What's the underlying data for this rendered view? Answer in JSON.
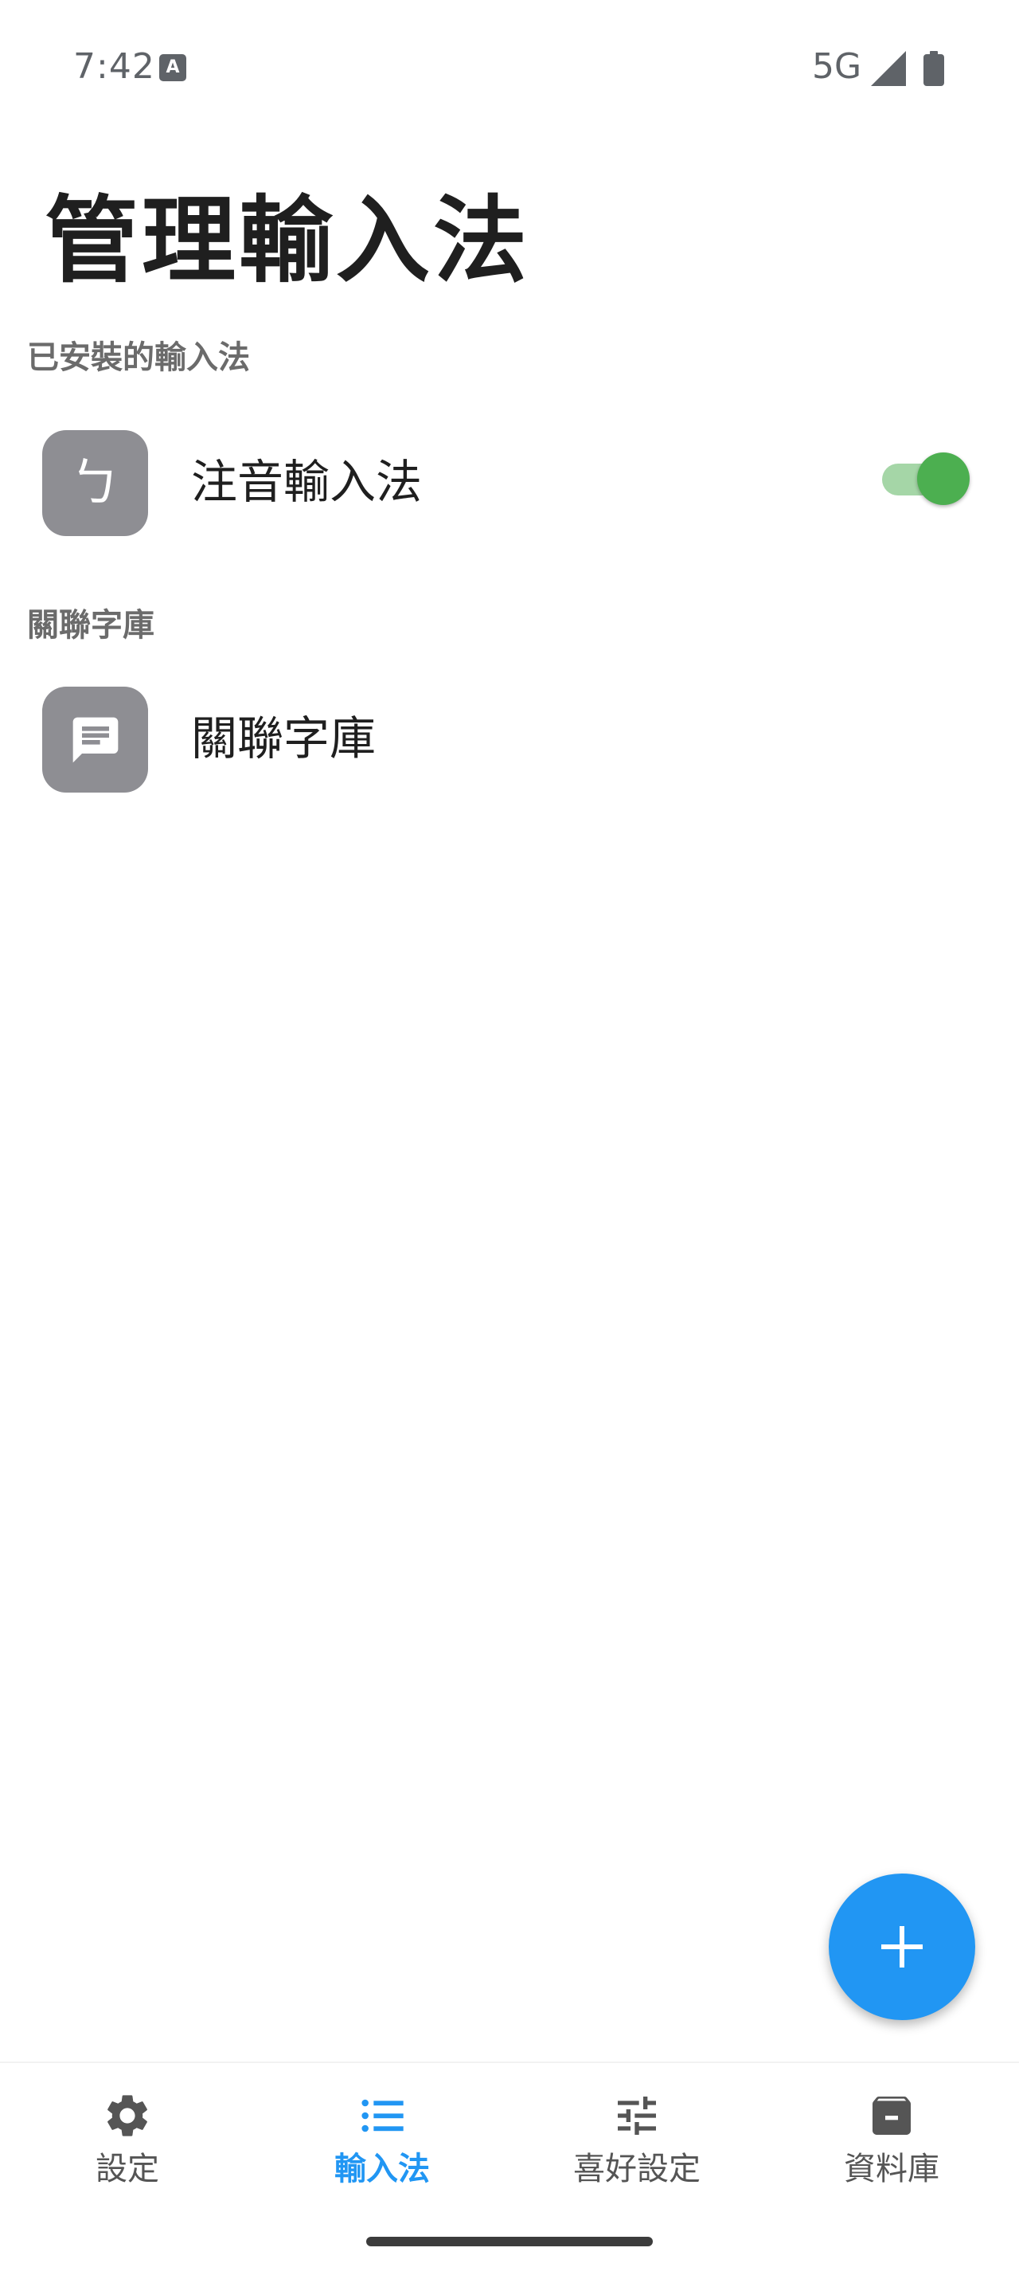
{
  "status_bar": {
    "time": "7:42",
    "keyboard_indicator": "A",
    "network": "5G",
    "icons": [
      "keyboard-a-icon",
      "signal-icon",
      "battery-icon"
    ]
  },
  "page": {
    "title": "管理輸入法"
  },
  "sections": {
    "installed": {
      "header": "已安裝的輸入法",
      "items": [
        {
          "icon": "bopomofo-icon",
          "glyph": "ㄅ",
          "label": "注音輸入法",
          "enabled": true
        }
      ]
    },
    "dictionary": {
      "header": "關聯字庫",
      "items": [
        {
          "icon": "message-icon",
          "label": "關聯字庫"
        }
      ]
    }
  },
  "fab": {
    "icon": "plus-icon"
  },
  "bottom_nav": {
    "active_index": 1,
    "items": [
      {
        "label": "設定",
        "icon": "gear-icon"
      },
      {
        "label": "輸入法",
        "icon": "list-icon"
      },
      {
        "label": "喜好設定",
        "icon": "sliders-icon"
      },
      {
        "label": "資料庫",
        "icon": "archive-icon"
      }
    ]
  },
  "colors": {
    "accent": "#2196f3",
    "toggle_on": "#4caf50",
    "toggle_track": "#a5d6a7",
    "icon_box": "#8e8e93",
    "section_header": "#6b6b6b",
    "nav_inactive": "#555555"
  }
}
